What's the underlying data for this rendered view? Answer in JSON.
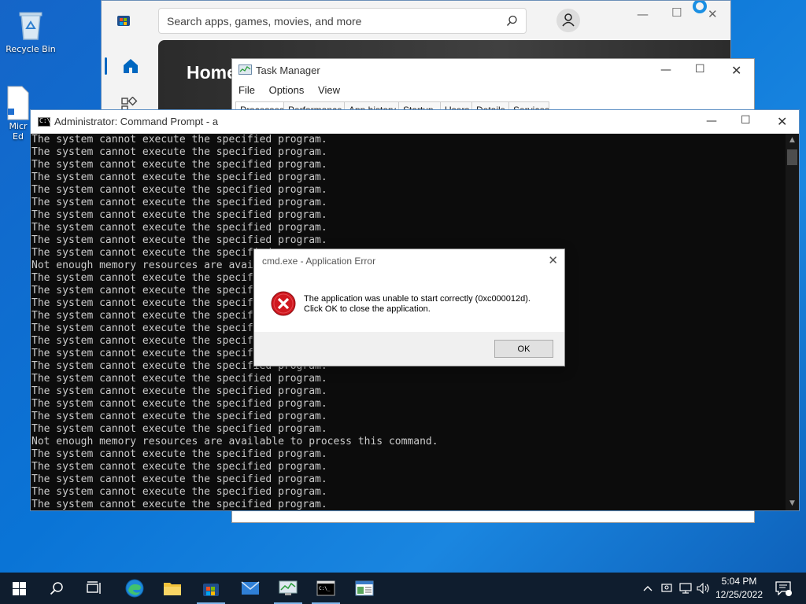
{
  "desktop": {
    "icons": [
      {
        "label": "Recycle Bin"
      },
      {
        "label": "Micr Ed"
      }
    ]
  },
  "store": {
    "search_placeholder": "Search apps, games, movies, and more",
    "home_title": "Home"
  },
  "task_manager": {
    "title": "Task Manager",
    "menu": [
      "File",
      "Options",
      "View"
    ],
    "tabs": [
      "Processes",
      "Performance",
      "App history",
      "Startup",
      "Users",
      "Details",
      "Services"
    ]
  },
  "cmd": {
    "title": "Administrator: Command Prompt - a",
    "lines": [
      "The system cannot execute the specified program.",
      "The system cannot execute the specified program.",
      "The system cannot execute the specified program.",
      "The system cannot execute the specified program.",
      "The system cannot execute the specified program.",
      "The system cannot execute the specified program.",
      "The system cannot execute the specified program.",
      "The system cannot execute the specified program.",
      "The system cannot execute the specified program.",
      "The system cannot execute the specified program.",
      "Not enough memory resources are available to process this command.",
      "The system cannot execute the specified program.",
      "The system cannot execute the specified program.",
      "The system cannot execute the specified program.",
      "The system cannot execute the specified program.",
      "The system cannot execute the specified program.",
      "The system cannot execute the specified program.",
      "The system cannot execute the specified program.",
      "The system cannot execute the specified program.",
      "The system cannot execute the specified program.",
      "The system cannot execute the specified program.",
      "The system cannot execute the specified program.",
      "The system cannot execute the specified program.",
      "The system cannot execute the specified program.",
      "Not enough memory resources are available to process this command.",
      "The system cannot execute the specified program.",
      "The system cannot execute the specified program.",
      "The system cannot execute the specified program.",
      "The system cannot execute the specified program.",
      "The system cannot execute the specified program."
    ]
  },
  "error_dialog": {
    "title": "cmd.exe - Application Error",
    "message_line1": "The application was unable to start correctly (0xc000012d).",
    "message_line2": "Click OK to close the application.",
    "ok_label": "OK"
  },
  "taskbar": {
    "apps": [
      "start",
      "search",
      "task-view",
      "edge",
      "file-explorer",
      "store",
      "mail",
      "task-manager",
      "command-prompt",
      "control-panel"
    ],
    "active_apps": [
      "store",
      "task-manager",
      "command-prompt"
    ],
    "time": "5:04 PM",
    "date": "12/25/2022"
  },
  "colors": {
    "desktop_bg": "#0a74d6",
    "taskbar_bg": "#0f1d2e",
    "console_bg": "#0c0c0c",
    "console_text": "#cccccc",
    "error_red": "#d0181f",
    "accent": "#0067c0"
  }
}
